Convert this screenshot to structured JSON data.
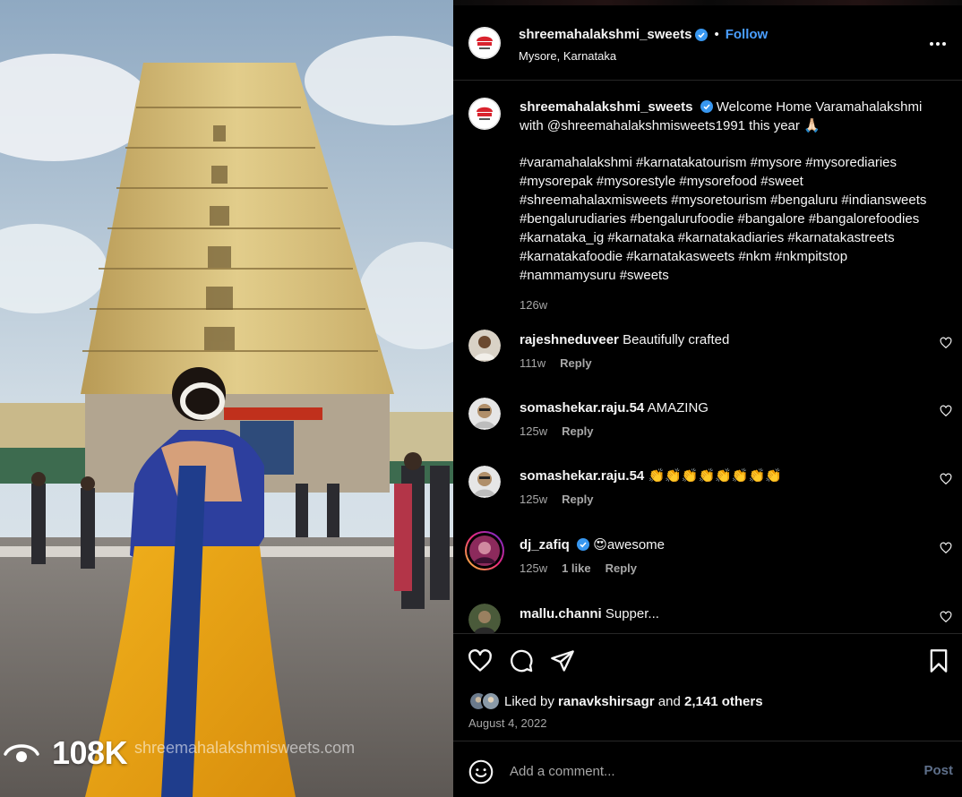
{
  "post": {
    "username": "shreemahalakshmi_sweets",
    "follow_label": "Follow",
    "separator": "•",
    "location": "Mysore, Karnataka",
    "views": "108K",
    "watermark": "shreemahalakshmisweets.com",
    "caption_text": "Welcome Home Varamahalakshmi with @shreemahalakshmisweets1991 this year 🙏🏻",
    "hashtags": "#varamahalakshmi #karnatakatourism #mysore #mysorediaries #mysorepak #mysorestyle #mysorefood #sweet #shreemahalaxmisweets #mysoretourism #bengaluru #indiansweets #bengalurudiaries #bengalurufoodie #bangalore #bangalorefoodies #karnataka_ig #karnataka #karnatakadiaries #karnatakastreets #karnatakafoodie #karnatakasweets #nkm #nkmpitstop #nammamysuru #sweets",
    "caption_time": "126w",
    "date": "August 4, 2022"
  },
  "comments": [
    {
      "user": "rajeshneduveer",
      "text": "Beautifully crafted",
      "time": "111w",
      "likes": "",
      "reply": "Reply"
    },
    {
      "user": "somashekar.raju.54",
      "text": "AMAZING",
      "time": "125w",
      "likes": "",
      "reply": "Reply"
    },
    {
      "user": "somashekar.raju.54",
      "text": "👏👏👏👏👏👏👏👏",
      "time": "125w",
      "likes": "",
      "reply": "Reply"
    },
    {
      "user": "dj_zafiq",
      "text": "😍awesome",
      "time": "125w",
      "likes": "1 like",
      "reply": "Reply"
    },
    {
      "user": "mallu.channi",
      "text": "Supper...",
      "time": "",
      "likes": "",
      "reply": ""
    }
  ],
  "likes": {
    "prefix": "Liked by",
    "user": "ranavkshirsagr",
    "middle": "and",
    "others": "2,141 others"
  },
  "composer": {
    "placeholder": "Add a comment...",
    "post_label": "Post"
  },
  "colors": {
    "accent": "#4a9eff",
    "background": "#000000",
    "muted_text": "#a8a8a8",
    "verified": "#3897f0"
  },
  "icons": [
    "eye-icon",
    "verified-icon",
    "more-icon",
    "heart-icon",
    "comment-icon",
    "share-icon",
    "save-icon",
    "emoji-icon"
  ]
}
